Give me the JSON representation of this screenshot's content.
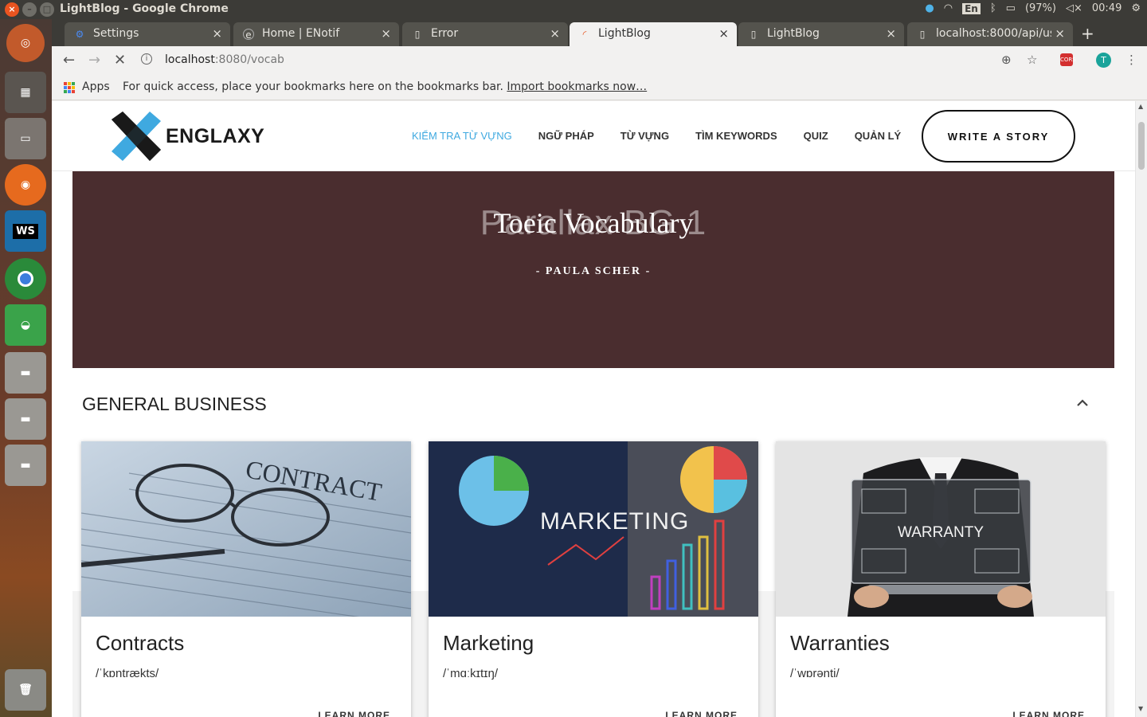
{
  "os": {
    "window_title": "LightBlog - Google Chrome",
    "lang": "En",
    "battery": "(97%)",
    "clock": "00:49"
  },
  "tabs": [
    {
      "label": "Settings",
      "icon": "gear-icon"
    },
    {
      "label": "Home | ENotif",
      "icon": "site-e-icon"
    },
    {
      "label": "Error",
      "icon": "page-icon"
    },
    {
      "label": "LightBlog",
      "icon": "loading-icon",
      "active": true
    },
    {
      "label": "LightBlog",
      "icon": "page-icon"
    },
    {
      "label": "localhost:8000/api/us",
      "icon": "page-icon"
    }
  ],
  "omnibox": {
    "host": "localhost",
    "path": ":8080/vocab"
  },
  "bookmarks": {
    "apps_label": "Apps",
    "hint": "For quick access, place your bookmarks here on the bookmarks bar. ",
    "import_label": "Import bookmarks now…"
  },
  "site": {
    "logo_text": "ENGLAXY",
    "nav": [
      {
        "label": "KIỂM TRA TỪ VỰNG",
        "active": true
      },
      {
        "label": "NGỮ PHÁP"
      },
      {
        "label": "TỪ VỰNG"
      },
      {
        "label": "TÌM KEYWORDS"
      },
      {
        "label": "QUIZ"
      },
      {
        "label": "QUẢN LÝ"
      }
    ],
    "cta": "WRITE A STORY",
    "accent_color": "#3fa9e0",
    "hero_color": "#4a2d2f"
  },
  "hero": {
    "ghost_text": "Parallax BG 1",
    "title": "Toeic Vocabulary",
    "author": "- PAULA SCHER -"
  },
  "section": {
    "title": "GENERAL BUSINESS",
    "cards": [
      {
        "word": "Contracts",
        "ipa": "/ˈkɒntrækts/",
        "more": "LEARN MORE",
        "image": "contract-photo",
        "image_text": "CONTRACT"
      },
      {
        "word": "Marketing",
        "ipa": "/ˈmɑːkɪtɪŋ/",
        "more": "LEARN MORE",
        "image": "marketing-photo",
        "image_text": "MARKETING"
      },
      {
        "word": "Warranties",
        "ipa": "/ˈwɒrənti/",
        "more": "LEARN MORE",
        "image": "warranty-photo",
        "image_text": "WARRANTY"
      }
    ]
  }
}
